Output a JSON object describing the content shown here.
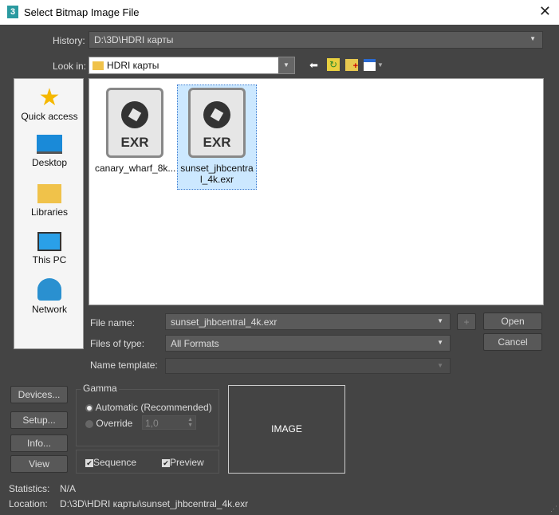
{
  "window": {
    "title": "Select Bitmap Image File",
    "app_icon": "3"
  },
  "history": {
    "label": "History:",
    "value": "D:\\3D\\HDRI карты"
  },
  "look_in": {
    "label": "Look in:",
    "value": "HDRI карты"
  },
  "sidebar": {
    "items": [
      {
        "label": "Quick access",
        "icon": "star-icon"
      },
      {
        "label": "Desktop",
        "icon": "desktop-icon"
      },
      {
        "label": "Libraries",
        "icon": "folder-icon"
      },
      {
        "label": "This PC",
        "icon": "monitor-icon"
      },
      {
        "label": "Network",
        "icon": "network-icon"
      }
    ]
  },
  "files": [
    {
      "name": "canary_wharf_8k...",
      "ext": "EXR",
      "selected": false
    },
    {
      "name": "sunset_jhbcentral_4k.exr",
      "ext": "EXR",
      "selected": true
    }
  ],
  "file_name": {
    "label": "File name:",
    "value": "sunset_jhbcentral_4k.exr"
  },
  "files_of_type": {
    "label": "Files of type:",
    "value": "All Formats"
  },
  "name_template": {
    "label": "Name template:",
    "value": ""
  },
  "buttons": {
    "plus": "+",
    "open": "Open",
    "cancel": "Cancel",
    "devices": "Devices...",
    "setup": "Setup...",
    "info": "Info...",
    "view": "View"
  },
  "gamma": {
    "title": "Gamma",
    "automatic": "Automatic (Recommended)",
    "override": "Override",
    "override_value": "1,0",
    "selected": "automatic"
  },
  "options": {
    "sequence": "Sequence",
    "preview": "Preview",
    "sequence_checked": true,
    "preview_checked": true
  },
  "preview_box": "IMAGE",
  "statistics": {
    "label": "Statistics:",
    "value": "N/A"
  },
  "location": {
    "label": "Location:",
    "value": "D:\\3D\\HDRI карты\\sunset_jhbcentral_4k.exr"
  }
}
